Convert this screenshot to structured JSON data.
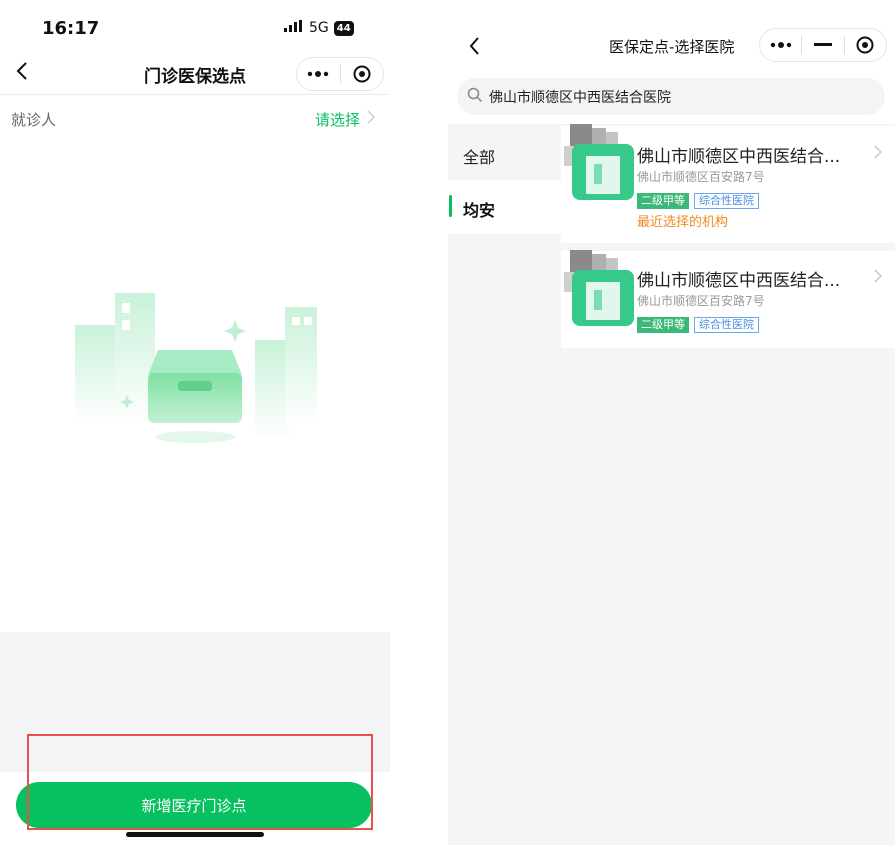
{
  "left_screen": {
    "status": {
      "time": "16:17",
      "network": "5G",
      "battery": "44"
    },
    "nav": {
      "title": "门诊医保选点"
    },
    "patient": {
      "label": "就诊人",
      "select_label": "请选择"
    },
    "add_button_label": "新增医疗门诊点"
  },
  "right_screen": {
    "nav": {
      "title": "医保定点-选择医院"
    },
    "search": {
      "value": "佛山市顺德区中西医结合医院"
    },
    "categories": [
      {
        "label": "全部",
        "active": false
      },
      {
        "label": "均安",
        "active": true
      }
    ],
    "hospitals": [
      {
        "name": "佛山市顺德区中西医结合...",
        "address": "佛山市顺德区百安路7号",
        "tags": [
          "二级甲等",
          "综合性医院"
        ],
        "note": "最近选择的机构"
      },
      {
        "name": "佛山市顺德区中西医结合...",
        "address": "佛山市顺德区百安路7号",
        "tags": [
          "二级甲等",
          "综合性医院"
        ]
      }
    ]
  },
  "colors": {
    "accent": "#07c160",
    "highlight_box": "#e5534b",
    "recent_note": "#f08a24",
    "tag_blue": "#4a8fe0"
  }
}
